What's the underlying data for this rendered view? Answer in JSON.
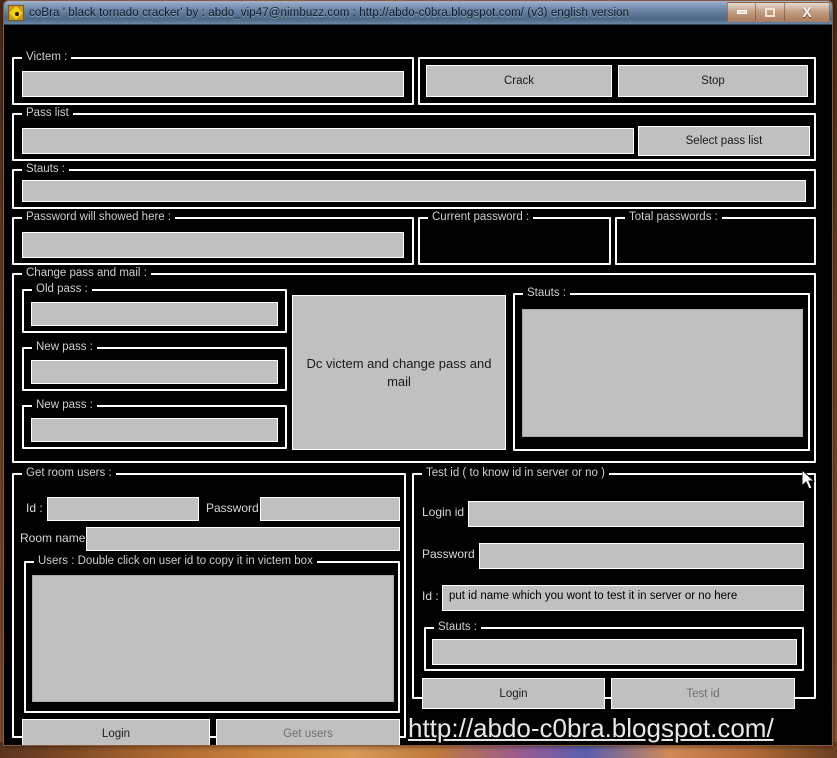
{
  "window": {
    "title": "coBra ' black tornado cracker' by : abdo_vip47@nimbuzz.com  ;  http://abdo-c0bra.blogspot.com/   (v3) english version",
    "icon": "cobra-app-icon",
    "controls": {
      "minimize": "minimize-icon",
      "maximize": "maximize-icon",
      "close": "X"
    }
  },
  "victim": {
    "caption": "Victem :",
    "input_value": "",
    "input_placeholder": ""
  },
  "actions": {
    "crack_label": "Crack",
    "stop_label": "Stop"
  },
  "pass_list": {
    "caption": "Pass list",
    "input_value": "",
    "select_label": "Select pass list"
  },
  "status_top": {
    "caption": "Stauts :",
    "value": ""
  },
  "password_result": {
    "caption": "Password will showed here :",
    "value": ""
  },
  "current_password": {
    "caption": "Current password :",
    "value": ""
  },
  "total_passwords": {
    "caption": "Total passwords :",
    "value": ""
  },
  "change_pass_and_mail": {
    "caption": "Change pass and mail :",
    "old_pass": {
      "caption": "Old pass :",
      "value": ""
    },
    "new_pass_1": {
      "caption": "New pass :",
      "value": ""
    },
    "new_pass_2": {
      "caption": "New pass :",
      "value": ""
    },
    "dc_button_label": "Dc victem and change pass and mail",
    "status": {
      "caption": "Stauts :",
      "value": ""
    }
  },
  "get_room_users": {
    "caption": "Get room users :",
    "id_label": "Id :",
    "id_value": "",
    "password_label": "Password :",
    "password_value": "",
    "room_name_label": "Room name :",
    "room_name_value": "",
    "users_caption": "Users : Double click on user id to copy it in victem box",
    "users_items": [],
    "login_label": "Login",
    "get_users_label": "Get users"
  },
  "test_id": {
    "caption": "Test id ( to know id in server or no )",
    "login_id_label": "Login id :",
    "login_id_value": "",
    "password_label": "Password :",
    "password_value": "",
    "id_label": "Id :",
    "id_value": "put id name which you wont to test it in server or no here",
    "status": {
      "caption": "Stauts :",
      "value": ""
    },
    "login_label": "Login",
    "test_id_label": "Test id"
  },
  "footer": {
    "blog_url": "http://abdo-c0bra.blogspot.com/"
  },
  "colors": {
    "window_bg": "#000000",
    "control_face": "#c0c0c0",
    "group_border": "#ffffff",
    "caption_text": "#cfcfcf",
    "titlebar_accent": "#5d7796"
  }
}
